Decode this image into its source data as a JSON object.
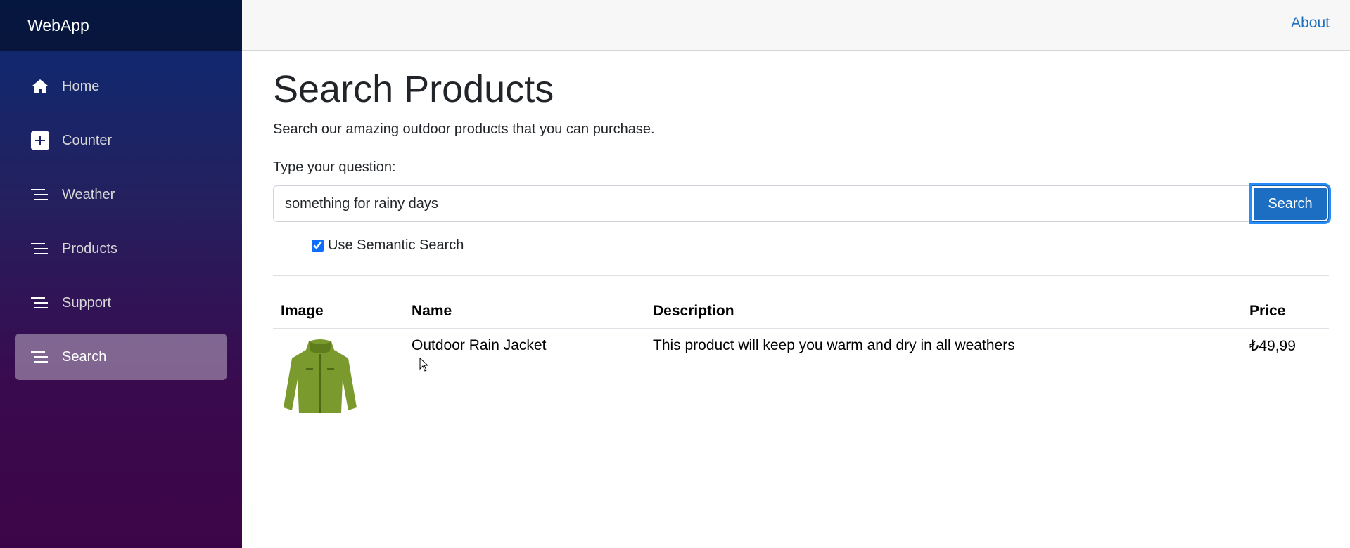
{
  "app": {
    "brand": "WebApp"
  },
  "sidebar": {
    "items": [
      {
        "label": "Home",
        "icon": "home-icon",
        "active": false
      },
      {
        "label": "Counter",
        "icon": "plus-icon",
        "active": false
      },
      {
        "label": "Weather",
        "icon": "list-icon",
        "active": false
      },
      {
        "label": "Products",
        "icon": "list-icon",
        "active": false
      },
      {
        "label": "Support",
        "icon": "list-icon",
        "active": false
      },
      {
        "label": "Search",
        "icon": "list-icon",
        "active": true
      }
    ]
  },
  "topbar": {
    "about_label": "About"
  },
  "page": {
    "title": "Search Products",
    "lead": "Search our amazing outdoor products that you can purchase.",
    "question_label": "Type your question:",
    "search_value": "something for rainy days",
    "search_button": "Search",
    "semantic_label": "Use Semantic Search",
    "semantic_checked": true
  },
  "table": {
    "headers": [
      "Image",
      "Name",
      "Description",
      "Price"
    ],
    "rows": [
      {
        "image": "green-rain-jacket",
        "name": "Outdoor Rain Jacket",
        "description": "This product will keep you warm and dry in all weathers",
        "price": "₺49,99"
      }
    ]
  },
  "colors": {
    "primary": "#1b6ec2",
    "sidebar_top": "#0a2a74",
    "sidebar_bottom": "#3c0547",
    "jacket": "#7a9a2e"
  }
}
